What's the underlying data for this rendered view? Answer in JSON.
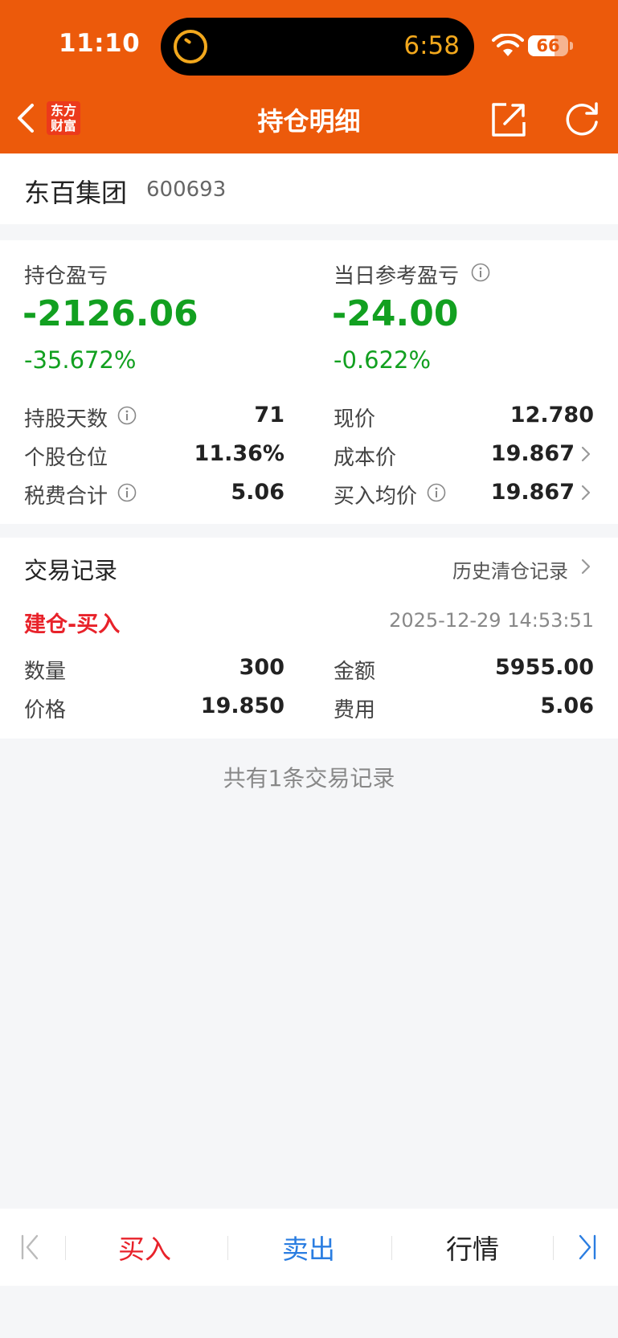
{
  "status_bar": {
    "time": "11:10",
    "island_timer": "6:58",
    "battery_level": "66",
    "battery_fraction": 0.66
  },
  "header": {
    "title": "持仓明细",
    "logo_line1": "东方",
    "logo_line2": "财富"
  },
  "stock": {
    "name": "东百集团",
    "code": "600693"
  },
  "summary": {
    "position_pl_label": "持仓盈亏",
    "position_pl_value": "-2126.06",
    "position_pl_pct": "-35.672%",
    "daily_pl_label": "当日参考盈亏",
    "daily_pl_value": "-24.00",
    "daily_pl_pct": "-0.622%",
    "hold_days_label": "持股天数",
    "hold_days_value": "71",
    "position_ratio_label": "个股仓位",
    "position_ratio_value": "11.36%",
    "fees_label": "税费合计",
    "fees_value": "5.06",
    "current_price_label": "现价",
    "current_price_value": "12.780",
    "cost_price_label": "成本价",
    "cost_price_value": "19.867",
    "avg_buy_label": "买入均价",
    "avg_buy_value": "19.867"
  },
  "trades": {
    "title": "交易记录",
    "history_link": "历史清仓记录",
    "record": {
      "type": "建仓-买入",
      "datetime": "2025-12-29 14:53:51",
      "qty_label": "数量",
      "qty_value": "300",
      "amount_label": "金额",
      "amount_value": "5955.00",
      "price_label": "价格",
      "price_value": "19.850",
      "fee_label": "费用",
      "fee_value": "5.06"
    },
    "count_text": "共有1条交易记录"
  },
  "bottom_bar": {
    "buy": "买入",
    "sell": "卖出",
    "quote": "行情"
  },
  "colors": {
    "brand": "#ec5a0b",
    "loss_green": "#12a020",
    "buy_red": "#e8222a",
    "sell_blue": "#2a7de1"
  }
}
